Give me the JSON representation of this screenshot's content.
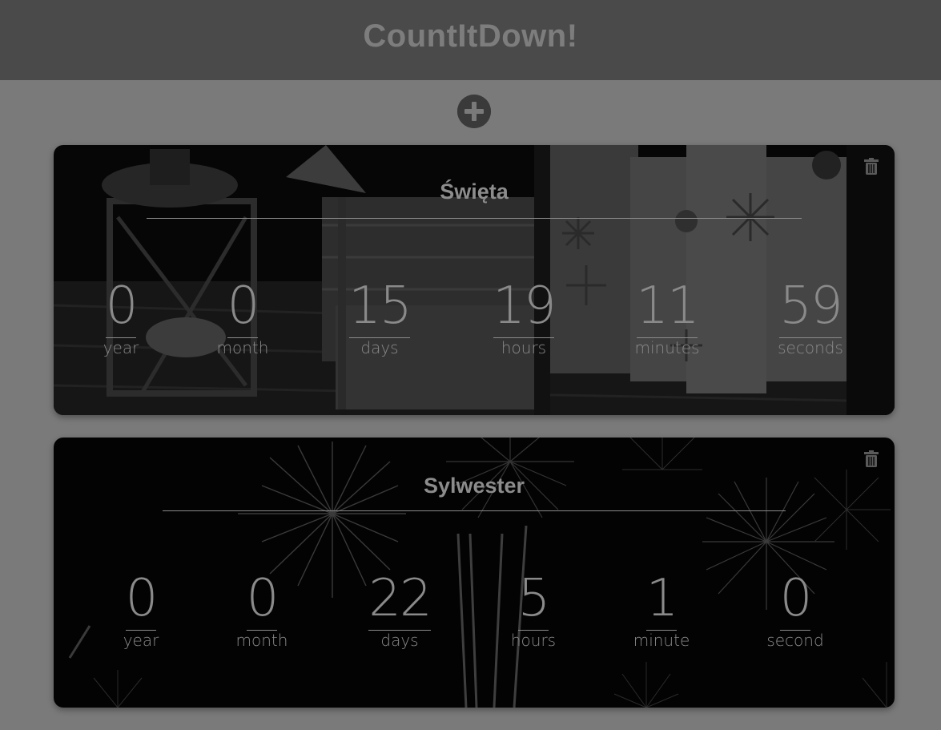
{
  "header": {
    "title": "CountItDown!"
  },
  "colors": {
    "header_background": "#4a4a4a",
    "page_background": "#7a7a7a",
    "title_text": "#7d7d7d",
    "card_text": "#8a8a8a"
  },
  "icons": {
    "add": "plus-circle-icon",
    "delete": "trash-icon"
  },
  "countdowns": [
    {
      "name": "Święta",
      "background": "dark photo of wrapped gifts and a lantern",
      "units": [
        {
          "value": "0",
          "label": "year"
        },
        {
          "value": "0",
          "label": "month"
        },
        {
          "value": "15",
          "label": "days"
        },
        {
          "value": "19",
          "label": "hours"
        },
        {
          "value": "11",
          "label": "minutes"
        },
        {
          "value": "59",
          "label": "seconds"
        }
      ]
    },
    {
      "name": "Sylwester",
      "background": "dark photo of fireworks",
      "units": [
        {
          "value": "0",
          "label": "year"
        },
        {
          "value": "0",
          "label": "month"
        },
        {
          "value": "22",
          "label": "days"
        },
        {
          "value": "5",
          "label": "hours"
        },
        {
          "value": "1",
          "label": "minute"
        },
        {
          "value": "0",
          "label": "second"
        }
      ]
    }
  ]
}
